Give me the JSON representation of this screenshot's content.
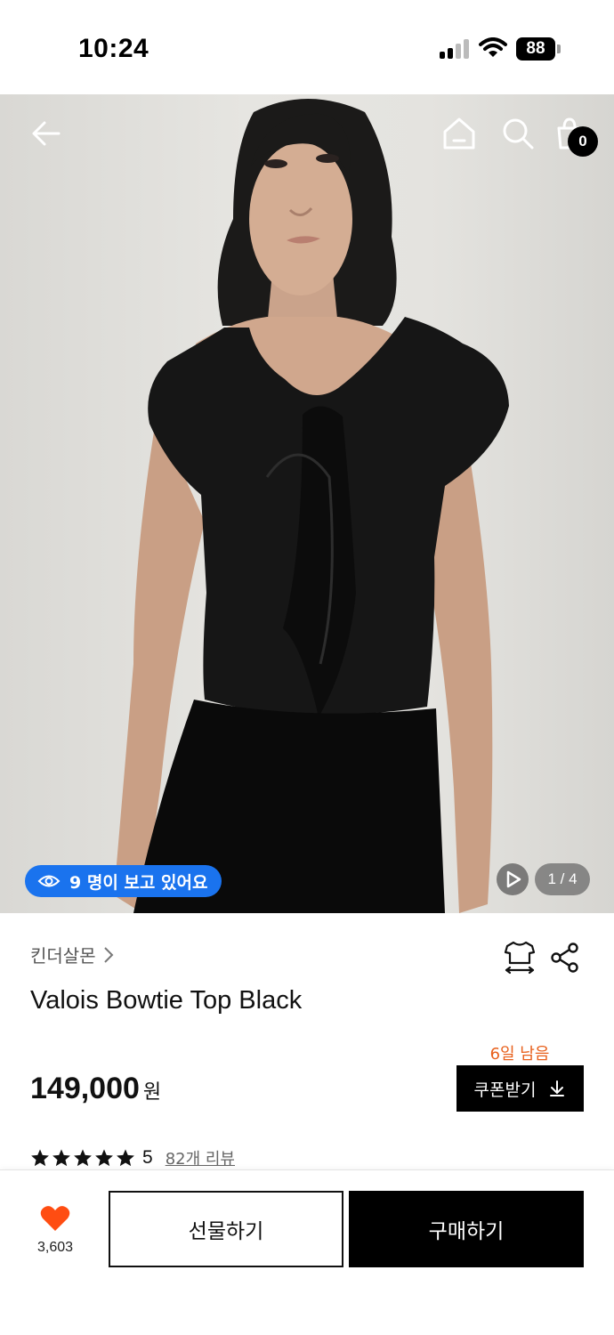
{
  "status_bar": {
    "time": "10:24",
    "battery": "88"
  },
  "header": {
    "cart_count": "0"
  },
  "hero": {
    "viewers_text": "9 명이 보고 있어요",
    "page_indicator": "1 / 4"
  },
  "product": {
    "brand": "킨더살몬",
    "title": "Valois Bowtie Top Black",
    "price": "149,000",
    "price_unit": "원",
    "coupon_deadline": "6일 남음",
    "coupon_label": "쿠폰받기",
    "rating": {
      "stars": 5,
      "score": "5",
      "reviews": "82개 리뷰"
    }
  },
  "bottom_bar": {
    "like_count": "3,603",
    "gift_label": "선물하기",
    "buy_label": "구매하기"
  },
  "colors": {
    "accent_blue": "#1a73ee",
    "deadline_orange": "#e8601c",
    "heart_orange": "#ff4d12",
    "primary_black": "#000000"
  },
  "icons": [
    "back-arrow-icon",
    "home-icon",
    "search-icon",
    "cart-icon",
    "eye-icon",
    "play-icon",
    "size-guide-icon",
    "share-icon",
    "download-icon",
    "star-icon",
    "heart-icon"
  ]
}
